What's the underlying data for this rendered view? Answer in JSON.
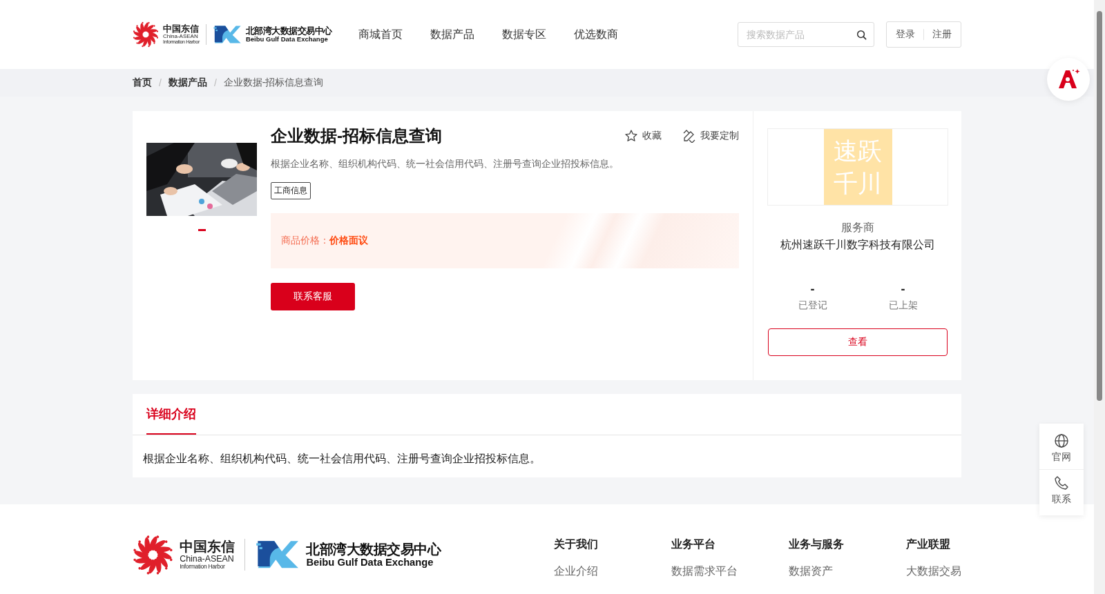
{
  "header": {
    "logo": {
      "partner_name": "中国东信",
      "partner_en": "China-ASEAN",
      "partner_sub": "Information Harbor",
      "exchange_name": "北部湾大数据交易中心",
      "exchange_en": "Beibu Gulf Data Exchange"
    },
    "nav": [
      {
        "label": "商城首页"
      },
      {
        "label": "数据产品"
      },
      {
        "label": "数据专区"
      },
      {
        "label": "优选数商"
      }
    ],
    "search": {
      "placeholder": "搜索数据产品"
    },
    "auth": [
      "登录",
      "注册"
    ]
  },
  "breadcrumb": {
    "separator": "/",
    "items": [
      {
        "label": "首页",
        "current": false
      },
      {
        "label": "数据产品",
        "current": false
      },
      {
        "label": "企业数据-招标信息查询",
        "current": true
      }
    ]
  },
  "product": {
    "title": "企业数据-招标信息查询",
    "actions": [
      {
        "label": "收藏",
        "kind": "star"
      },
      {
        "label": "我要定制",
        "kind": "custom"
      }
    ],
    "description": "根据企业名称、组织机构代码、统一社会信用代码、注册号查询企业招投标信息。",
    "tags": [
      "工商信息"
    ],
    "price": {
      "label": "商品价格：",
      "value": "价格面议"
    },
    "contact_button": "联系客服",
    "carousel": [
      {
        "selected": true
      }
    ]
  },
  "provider": {
    "logo_text": [
      "速跃",
      "千川"
    ],
    "role": "服务商",
    "name": "杭州速跃千川数字科技有限公司",
    "stats": [
      {
        "value": "-",
        "label": "已登记"
      },
      {
        "value": "-",
        "label": "已上架"
      }
    ],
    "button": "查看"
  },
  "detail": {
    "tabs": [
      {
        "label": "详细介绍",
        "selected": true
      }
    ],
    "body": "根据企业名称、组织机构代码、统一社会信用代码、注册号查询企业招投标信息。"
  },
  "footer": {
    "logo": {
      "partner_name": "中国东信",
      "partner_en": "China-ASEAN",
      "partner_sub": "Information Harbor",
      "exchange_name": "北部湾大数据交易中心",
      "exchange_en": "Beibu Gulf Data Exchange"
    },
    "columns": [
      {
        "title": "关于我们",
        "links": [
          "企业介绍"
        ]
      },
      {
        "title": "业务平台",
        "links": [
          "数据需求平台"
        ]
      },
      {
        "title": "业务与服务",
        "links": [
          "数据资产"
        ]
      },
      {
        "title": "产业联盟",
        "links": [
          "大数据交易"
        ]
      }
    ]
  },
  "side_tools": [
    {
      "label": "官网",
      "kind": "globe"
    },
    {
      "label": "联系",
      "kind": "phone"
    }
  ]
}
